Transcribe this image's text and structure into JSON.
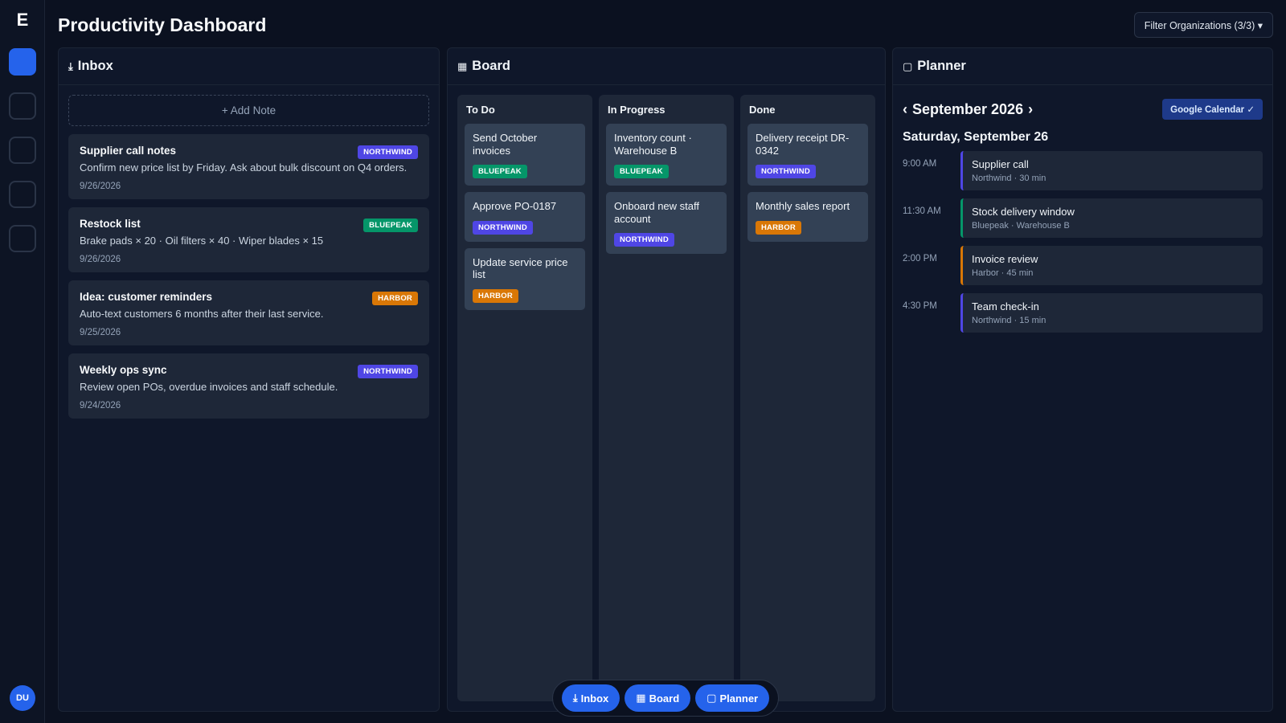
{
  "app": {
    "logo": "E",
    "title": "Productivity Dashboard",
    "avatar": "DU"
  },
  "header": {
    "filter_label": "Filter Organizations (3/3) ▾"
  },
  "colors": {
    "accent": "#2563eb",
    "northwind": "#4f46e5",
    "bluepeak": "#059669",
    "harbor": "#d97706"
  },
  "inbox": {
    "title": "Inbox",
    "icon": "download-icon",
    "add_note": "+ Add Note",
    "notes": [
      {
        "title": "Supplier call notes",
        "badge": "NORTHWIND",
        "body": "Confirm new price list by Friday. Ask about bulk discount on Q4 orders.",
        "date": "9/26/2026"
      },
      {
        "title": "Restock list",
        "badge": "BLUEPEAK",
        "body": "Brake pads × 20 · Oil filters × 40 · Wiper blades × 15",
        "date": "9/26/2026"
      },
      {
        "title": "Idea: customer reminders",
        "badge": "HARBOR",
        "body": "Auto-text customers 6 months after their last service.",
        "date": "9/25/2026"
      },
      {
        "title": "Weekly ops sync",
        "badge": "NORTHWIND",
        "body": "Review open POs, overdue invoices and staff schedule.",
        "date": "9/24/2026"
      }
    ]
  },
  "board": {
    "title": "Board",
    "icon": "board-icon",
    "columns": [
      {
        "title": "To Do",
        "cards": [
          {
            "title": "Send October invoices",
            "badge": "BLUEPEAK"
          },
          {
            "title": "Approve PO-0187",
            "badge": "NORTHWIND"
          },
          {
            "title": "Update service price list",
            "badge": "HARBOR"
          }
        ]
      },
      {
        "title": "In Progress",
        "cards": [
          {
            "title": "Inventory count · Warehouse B",
            "badge": "BLUEPEAK"
          },
          {
            "title": "Onboard new staff account",
            "badge": "NORTHWIND"
          }
        ]
      },
      {
        "title": "Done",
        "cards": [
          {
            "title": "Delivery receipt DR-0342",
            "badge": "NORTHWIND"
          },
          {
            "title": "Monthly sales report",
            "badge": "HARBOR"
          }
        ]
      }
    ]
  },
  "planner": {
    "title": "Planner",
    "icon": "calendar-icon",
    "prev": "‹",
    "month": "September 2026",
    "next": "›",
    "gcal": "Google Calendar ✓",
    "day": "Saturday, September 26",
    "events": [
      {
        "time": "9:00 AM",
        "title": "Supplier call",
        "meta": "Northwind · 30 min",
        "org": "northwind"
      },
      {
        "time": "11:30 AM",
        "title": "Stock delivery window",
        "meta": "Bluepeak · Warehouse B",
        "org": "bluepeak"
      },
      {
        "time": "2:00 PM",
        "title": "Invoice review",
        "meta": "Harbor · 45 min",
        "org": "harbor"
      },
      {
        "time": "4:30 PM",
        "title": "Team check-in",
        "meta": "Northwind · 15 min",
        "org": "northwind"
      }
    ]
  },
  "tabs": [
    {
      "icon": "⤓",
      "label": "Inbox"
    },
    {
      "icon": "▦",
      "label": "Board"
    },
    {
      "icon": "▢",
      "label": "Planner"
    }
  ],
  "glyphs": {
    "inbox": "⤓",
    "board": "▦",
    "planner": "▢"
  }
}
